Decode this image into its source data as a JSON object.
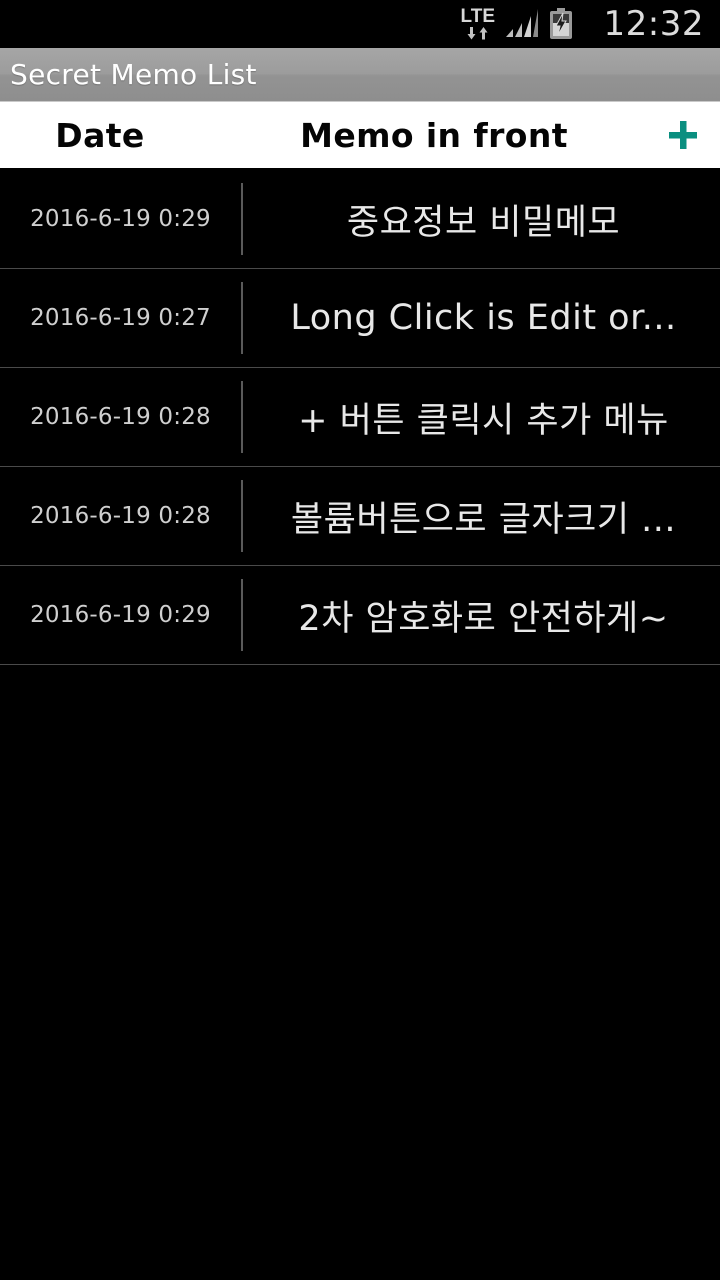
{
  "status_bar": {
    "network_label": "LTE",
    "network_icon": "lte-data-arrows-icon",
    "signal_icon": "signal-bars-icon",
    "battery_icon": "battery-charging-icon",
    "time": "12:32"
  },
  "title_bar": {
    "title": "Secret Memo List"
  },
  "list_header": {
    "date_column": "Date",
    "memo_column": "Memo in front",
    "add_button_icon": "plus-icon",
    "add_button_color": "#0a8f80"
  },
  "memos": [
    {
      "date": "2016-6-19 0:29",
      "text": "중요정보  비밀메모"
    },
    {
      "date": "2016-6-19 0:27",
      "text": "Long Click  is Edit or..."
    },
    {
      "date": "2016-6-19 0:28",
      "text": "+ 버튼 클릭시 추가 메뉴"
    },
    {
      "date": "2016-6-19 0:28",
      "text": "볼륨버튼으로 글자크기 ..."
    },
    {
      "date": "2016-6-19 0:29",
      "text": "2차 암호화로 안전하게~"
    }
  ],
  "theme": {
    "background": "#000000",
    "title_bar_bg": "#9a9a9a",
    "header_bg": "#ffffff",
    "accent": "#0a8f80",
    "row_text": "#e8e8e8",
    "date_text": "#cfcfcf"
  }
}
